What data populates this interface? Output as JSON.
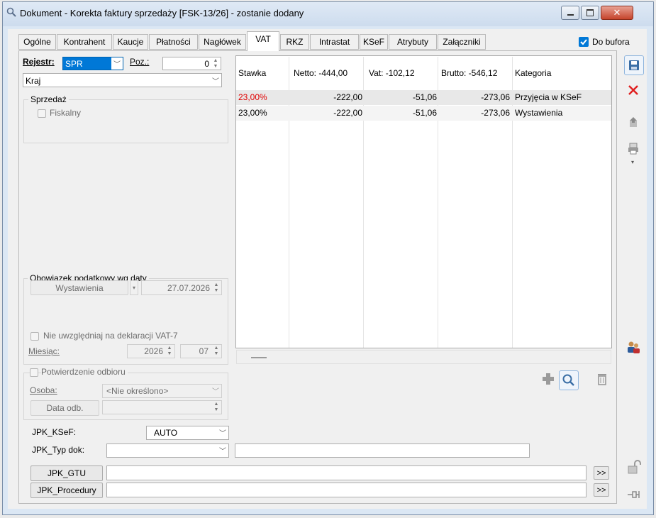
{
  "window": {
    "title": "Dokument - Korekta faktury sprzedaży [FSK-13/26]  - zostanie dodany"
  },
  "tabs": [
    "Ogólne",
    "Kontrahent",
    "Kaucje",
    "Płatności",
    "Nagłówek",
    "VAT",
    "RKZ",
    "Intrastat",
    "KSeF",
    "Atrybuty",
    "Załączniki"
  ],
  "active_tab": "VAT",
  "do_bufora": {
    "label": "Do bufora",
    "checked": true
  },
  "left": {
    "rejestr_label": "Rejestr:",
    "rejestr_value": "SPR",
    "poz_label": "Poz.:",
    "poz_value": "0",
    "kraj_value": "Kraj",
    "sprzedaz_group": "Sprzedaż",
    "fiskalny_label": "Fiskalny",
    "obowiazek_label": "Obowiązek podatkowy wg daty",
    "obowiazek_type": "Wystawienia",
    "obowiazek_date": "27.07.2026",
    "nie_uwzgledniaj_label": "Nie uwzględniaj na deklaracji VAT-7",
    "miesiac_label": "Miesiąc:",
    "miesiac_year": "2026",
    "miesiac_month": "07",
    "potwierdzenie_label": "Potwierdzenie odbioru",
    "osoba_label": "Osoba:",
    "osoba_value": "<Nie określono>",
    "data_odb_label": "Data odb.",
    "jpk_ksef_label": "JPK_KSeF:",
    "jpk_ksef_value": "AUTO",
    "jpk_typ_label": "JPK_Typ dok:",
    "jpk_gtu_label": "JPK_GTU",
    "jpk_procedury_label": "JPK_Procedury",
    "more_label": ">>"
  },
  "grid": {
    "headers": {
      "stawka": "Stawka",
      "netto": "Netto: -444,00",
      "vat": "Vat: -102,12",
      "brutto": "Brutto: -546,12",
      "kategoria": "Kategoria"
    },
    "rows": [
      {
        "stawka": "23,00%",
        "netto": "-222,00",
        "vat": "-51,06",
        "brutto": "-273,06",
        "kategoria": "Przyjęcia w KSeF"
      },
      {
        "stawka": "23,00%",
        "netto": "-222,00",
        "vat": "-51,06",
        "brutto": "-273,06",
        "kategoria": "Wystawienia"
      }
    ]
  },
  "colors": {
    "accent": "#0078d7",
    "row_highlight_text": "#e00000",
    "select_bg": "#0078d7"
  }
}
